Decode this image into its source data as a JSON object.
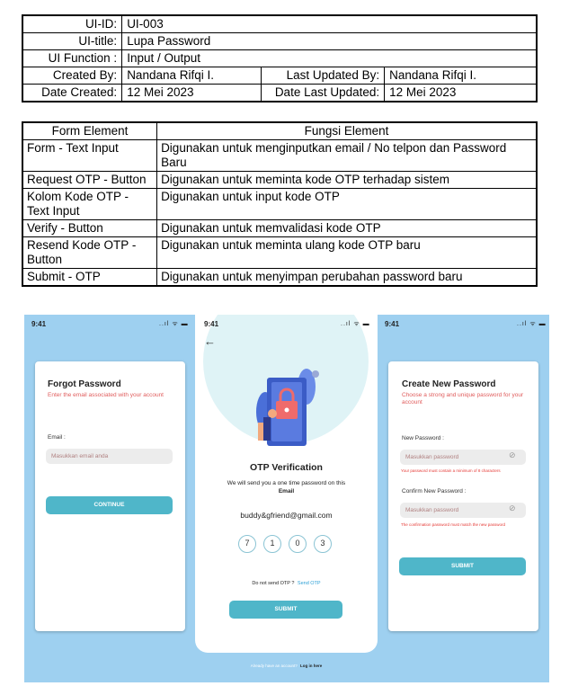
{
  "meta": {
    "ui_id_label": "UI-ID:",
    "ui_id": "UI-003",
    "ui_title_label": "UI-title:",
    "ui_title": "Lupa Password",
    "ui_function_label": "UI Function :",
    "ui_function": "Input / Output",
    "created_by_label": "Created By:",
    "created_by": "Nandana Rifqi I.",
    "last_updated_by_label": "Last Updated By:",
    "last_updated_by": "Nandana Rifqi I.",
    "date_created_label": "Date Created:",
    "date_created": "12 Mei 2023",
    "date_last_updated_label": "Date Last Updated:",
    "date_last_updated": "12 Mei 2023"
  },
  "functions": {
    "header_element": "Form Element",
    "header_function": "Fungsi Element",
    "rows": [
      {
        "element": "Form - Text Input",
        "function": "Digunakan untuk menginputkan email / No telpon dan Password Baru"
      },
      {
        "element": "Request OTP - Button",
        "function": "Digunakan untuk meminta kode OTP terhadap sistem"
      },
      {
        "element": "Kolom Kode OTP - Text Input",
        "function": "Digunakan untuk input kode OTP"
      },
      {
        "element": "Verify - Button",
        "function": "Digunakan untuk memvalidasi kode OTP"
      },
      {
        "element": "Resend Kode OTP - Button",
        "function": "Digunakan untuk meminta ulang kode OTP baru"
      },
      {
        "element": "Submit - OTP",
        "function": "Digunakan untuk menyimpan perubahan password baru"
      }
    ]
  },
  "mockup": {
    "time": "9:41",
    "signal": "..ıl ᯤ ▬",
    "forgot": {
      "title": "Forgot Password",
      "subtitle": "Enter the email associated with your account",
      "email_label": "Email :",
      "email_placeholder": "Masukkan email anda",
      "continue": "CONTINUE"
    },
    "otp": {
      "title": "OTP Verification",
      "desc1": "We will send you a one time password on this",
      "desc2": "Email",
      "email": "buddy&gfriend@gmail.com",
      "digits": [
        "7",
        "1",
        "0",
        "3"
      ],
      "resend_q": "Do not send OTP ?",
      "resend_link": "Send OTP",
      "submit": "SUBMIT",
      "footer_q": "Already have an account?",
      "footer_link": "Log in here"
    },
    "create": {
      "title": "Create New Password",
      "subtitle": "Choose a strong and unique password for your account",
      "new_label": "New Password :",
      "new_placeholder": "Masukkan password",
      "new_error": "Your password must contain a minimum of 8 characters",
      "confirm_label": "Confirm New Password :",
      "confirm_placeholder": "Masukkan password",
      "confirm_error": "The confirmation password must match the new password",
      "submit": "SUBMIT"
    }
  }
}
